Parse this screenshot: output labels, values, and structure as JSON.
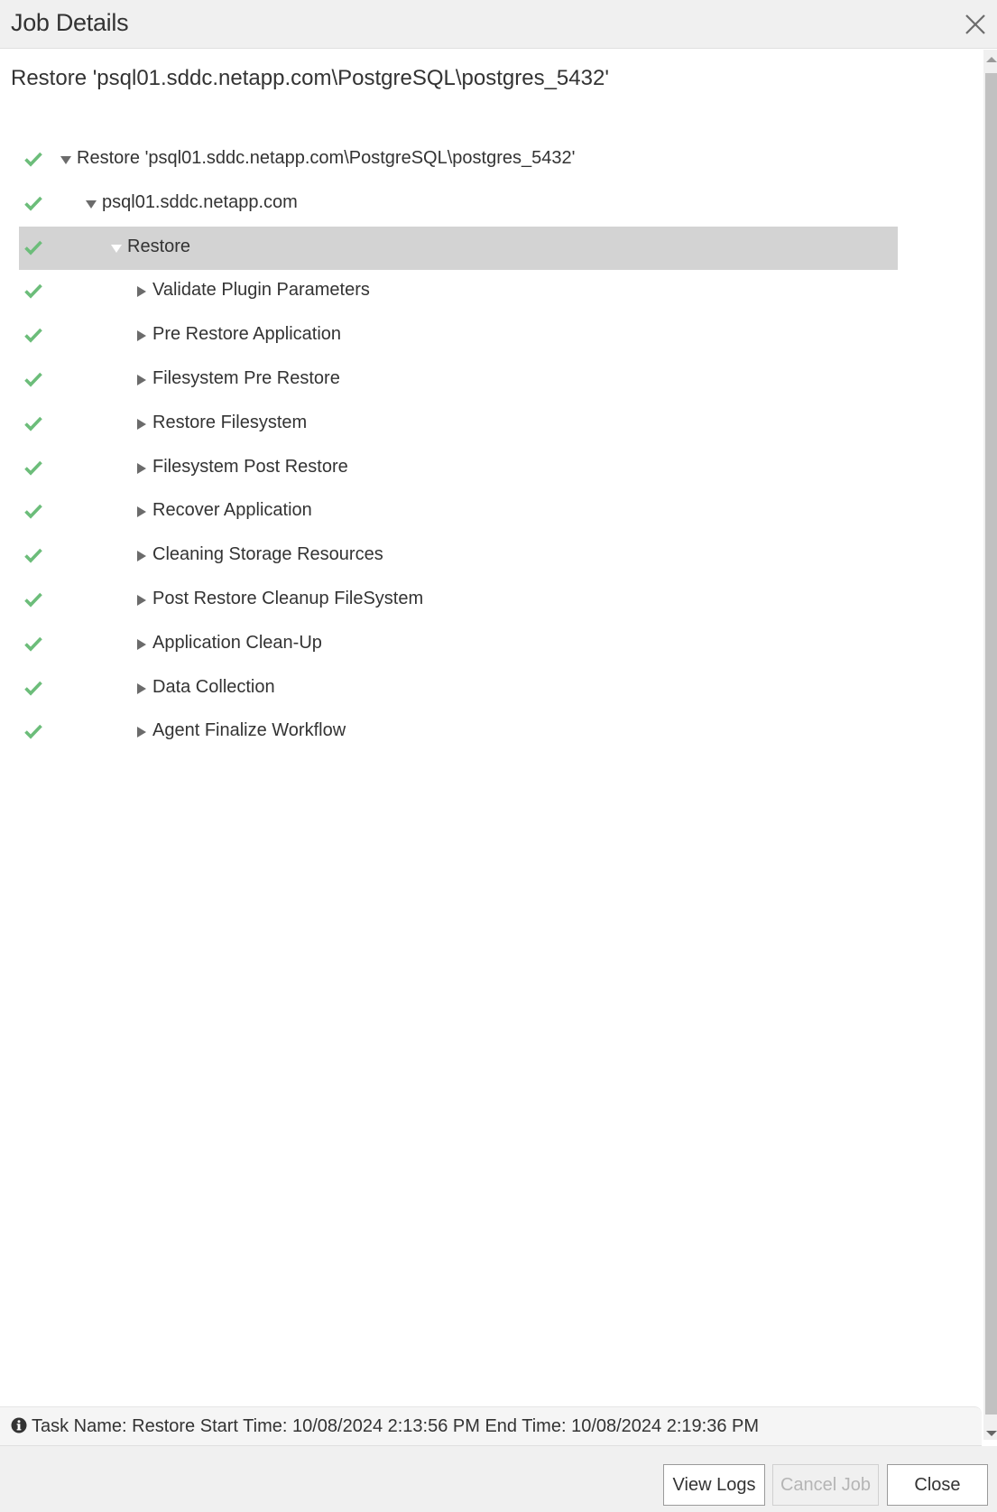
{
  "dialog": {
    "title": "Job Details",
    "close_icon": "close-x-icon"
  },
  "job": {
    "title": "Restore 'psql01.sddc.netapp.com\\PostgreSQL\\postgres_5432'"
  },
  "colors": {
    "success": "#6cbd7a",
    "selected_row": "#d3d3d3",
    "header_bg": "#f0f0f0"
  },
  "tree": [
    {
      "label": "Restore 'psql01.sddc.netapp.com\\PostgreSQL\\postgres_5432'",
      "level": 0,
      "expanded": true,
      "status": "success",
      "selected": false
    },
    {
      "label": "psql01.sddc.netapp.com",
      "level": 1,
      "expanded": true,
      "status": "success",
      "selected": false
    },
    {
      "label": "Restore",
      "level": 2,
      "expanded": true,
      "status": "success",
      "selected": true
    },
    {
      "label": "Validate Plugin Parameters",
      "level": 3,
      "expanded": false,
      "status": "success",
      "selected": false
    },
    {
      "label": "Pre Restore Application",
      "level": 3,
      "expanded": false,
      "status": "success",
      "selected": false
    },
    {
      "label": "Filesystem Pre Restore",
      "level": 3,
      "expanded": false,
      "status": "success",
      "selected": false
    },
    {
      "label": "Restore Filesystem",
      "level": 3,
      "expanded": false,
      "status": "success",
      "selected": false
    },
    {
      "label": "Filesystem Post Restore",
      "level": 3,
      "expanded": false,
      "status": "success",
      "selected": false
    },
    {
      "label": "Recover Application",
      "level": 3,
      "expanded": false,
      "status": "success",
      "selected": false
    },
    {
      "label": "Cleaning Storage Resources",
      "level": 3,
      "expanded": false,
      "status": "success",
      "selected": false
    },
    {
      "label": "Post Restore Cleanup FileSystem",
      "level": 3,
      "expanded": false,
      "status": "success",
      "selected": false
    },
    {
      "label": "Application Clean-Up",
      "level": 3,
      "expanded": false,
      "status": "success",
      "selected": false
    },
    {
      "label": "Data Collection",
      "level": 3,
      "expanded": false,
      "status": "success",
      "selected": false
    },
    {
      "label": "Agent Finalize Workflow",
      "level": 3,
      "expanded": false,
      "status": "success",
      "selected": false
    }
  ],
  "info": {
    "text": "Task Name: Restore Start Time: 10/08/2024 2:13:56 PM End Time: 10/08/2024 2:19:36 PM"
  },
  "footer": {
    "view_logs": "View Logs",
    "cancel_job": "Cancel Job",
    "close": "Close"
  }
}
